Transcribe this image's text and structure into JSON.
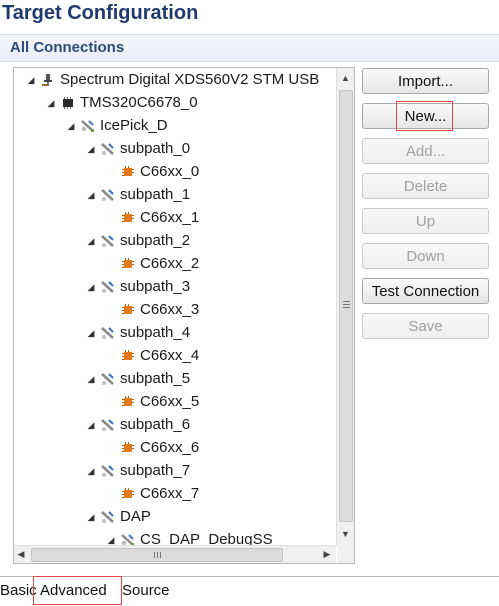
{
  "page": {
    "title": "Target Configuration"
  },
  "section": {
    "title": "All Connections"
  },
  "tree": [
    {
      "label": "Spectrum Digital XDS560V2 STM USB",
      "icon": "connection-icon",
      "level": 0,
      "expanded": true
    },
    {
      "label": "TMS320C6678_0",
      "icon": "chip-icon",
      "level": 1,
      "expanded": true
    },
    {
      "label": "IcePick_D",
      "icon": "router-icon",
      "level": 2,
      "expanded": true
    },
    {
      "label": "subpath_0",
      "icon": "subpath-icon",
      "level": 3,
      "expanded": true
    },
    {
      "label": "C66xx_0",
      "icon": "cpu-icon",
      "level": 4
    },
    {
      "label": "subpath_1",
      "icon": "subpath-icon",
      "level": 3,
      "expanded": true
    },
    {
      "label": "C66xx_1",
      "icon": "cpu-icon",
      "level": 4
    },
    {
      "label": "subpath_2",
      "icon": "subpath-icon",
      "level": 3,
      "expanded": true
    },
    {
      "label": "C66xx_2",
      "icon": "cpu-icon",
      "level": 4
    },
    {
      "label": "subpath_3",
      "icon": "subpath-icon",
      "level": 3,
      "expanded": true
    },
    {
      "label": "C66xx_3",
      "icon": "cpu-icon",
      "level": 4
    },
    {
      "label": "subpath_4",
      "icon": "subpath-icon",
      "level": 3,
      "expanded": true
    },
    {
      "label": "C66xx_4",
      "icon": "cpu-icon",
      "level": 4
    },
    {
      "label": "subpath_5",
      "icon": "subpath-icon",
      "level": 3,
      "expanded": true
    },
    {
      "label": "C66xx_5",
      "icon": "cpu-icon",
      "level": 4
    },
    {
      "label": "subpath_6",
      "icon": "subpath-icon",
      "level": 3,
      "expanded": true
    },
    {
      "label": "C66xx_6",
      "icon": "cpu-icon",
      "level": 4
    },
    {
      "label": "subpath_7",
      "icon": "subpath-icon",
      "level": 3,
      "expanded": true
    },
    {
      "label": "C66xx_7",
      "icon": "cpu-icon",
      "level": 4
    },
    {
      "label": "DAP",
      "icon": "subpath-icon",
      "level": 3,
      "expanded": true
    },
    {
      "label": "CS_DAP_DebugSS",
      "icon": "router-icon",
      "level": 4,
      "expanded": true
    }
  ],
  "buttons": {
    "import": "Import...",
    "new": "New...",
    "add": "Add...",
    "delete": "Delete",
    "up": "Up",
    "down": "Down",
    "test_connection": "Test Connection",
    "save": "Save"
  },
  "button_states": {
    "import": "enabled",
    "new": "enabled",
    "add": "disabled",
    "delete": "disabled",
    "up": "disabled",
    "down": "disabled",
    "test_connection": "enabled",
    "save": "disabled"
  },
  "tabs": {
    "basic": "Basic",
    "advanced": "Advanced",
    "source": "Source"
  },
  "colors": {
    "title": "#1f3a6e",
    "section_title": "#2c4a7a",
    "highlight": "#e04848",
    "cpu_icon": "#e07a1a"
  }
}
